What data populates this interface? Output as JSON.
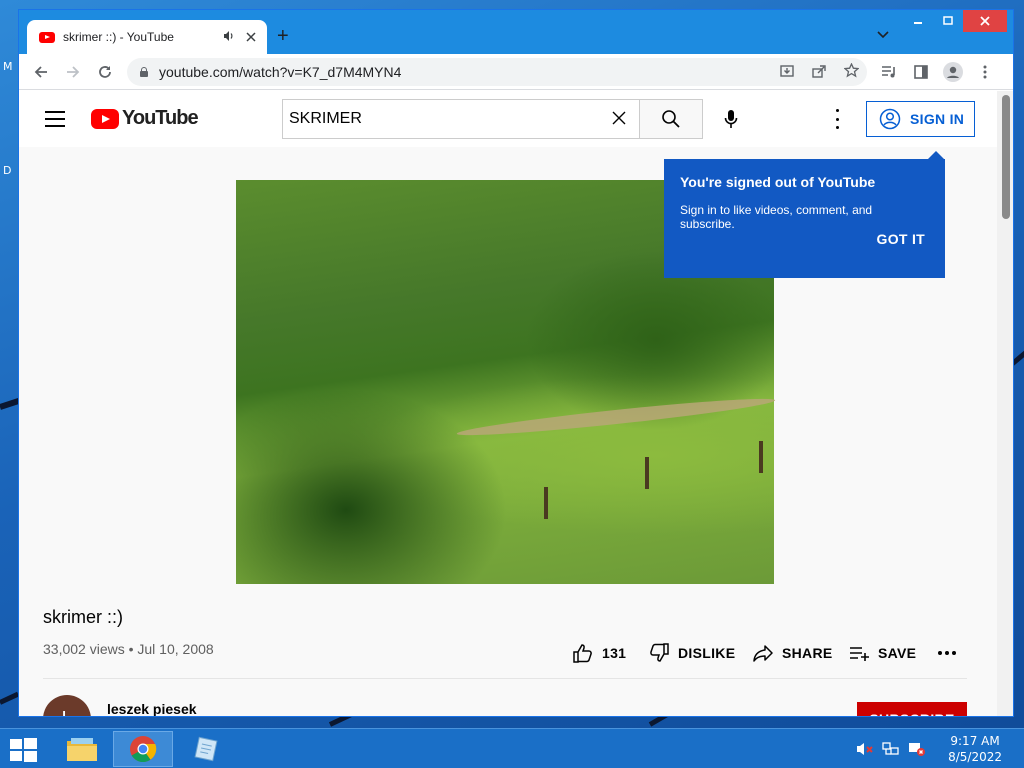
{
  "desktop": {
    "edge_labels": [
      "M",
      "D"
    ]
  },
  "browser": {
    "tab": {
      "title": "skrimer ::) - YouTube",
      "audio_icon": "speaker-icon",
      "close_icon": "close-icon"
    },
    "new_tab_label": "+",
    "address_bar": {
      "url": "youtube.com/watch?v=K7_d7M4MYN4"
    }
  },
  "youtube": {
    "logo_text": "YouTube",
    "search": {
      "value": "SKRIMER"
    },
    "sign_in_label": "SIGN IN",
    "tooltip": {
      "title": "You're signed out of YouTube",
      "body": "Sign in to like videos, comment, and subscribe.",
      "button": "GOT IT"
    },
    "video": {
      "title": "skrimer ::)",
      "views": "33,002 views",
      "date": "Jul 10, 2008",
      "meta": "33,002 views • Jul 10, 2008"
    },
    "actions": {
      "likes": "131",
      "dislike": "DISLIKE",
      "share": "SHARE",
      "save": "SAVE"
    },
    "channel": {
      "avatar_letter": "L",
      "name": "leszek piesek",
      "subscribe": "SUBSCRIBE"
    }
  },
  "taskbar": {
    "time": "9:17 AM",
    "date": "8/5/2022"
  },
  "colors": {
    "chrome_frame": "#1d8be0",
    "youtube_red": "#ff0000",
    "link_blue": "#065fd4",
    "tooltip_blue": "#1259c3",
    "subscribe_red": "#cc0000"
  }
}
